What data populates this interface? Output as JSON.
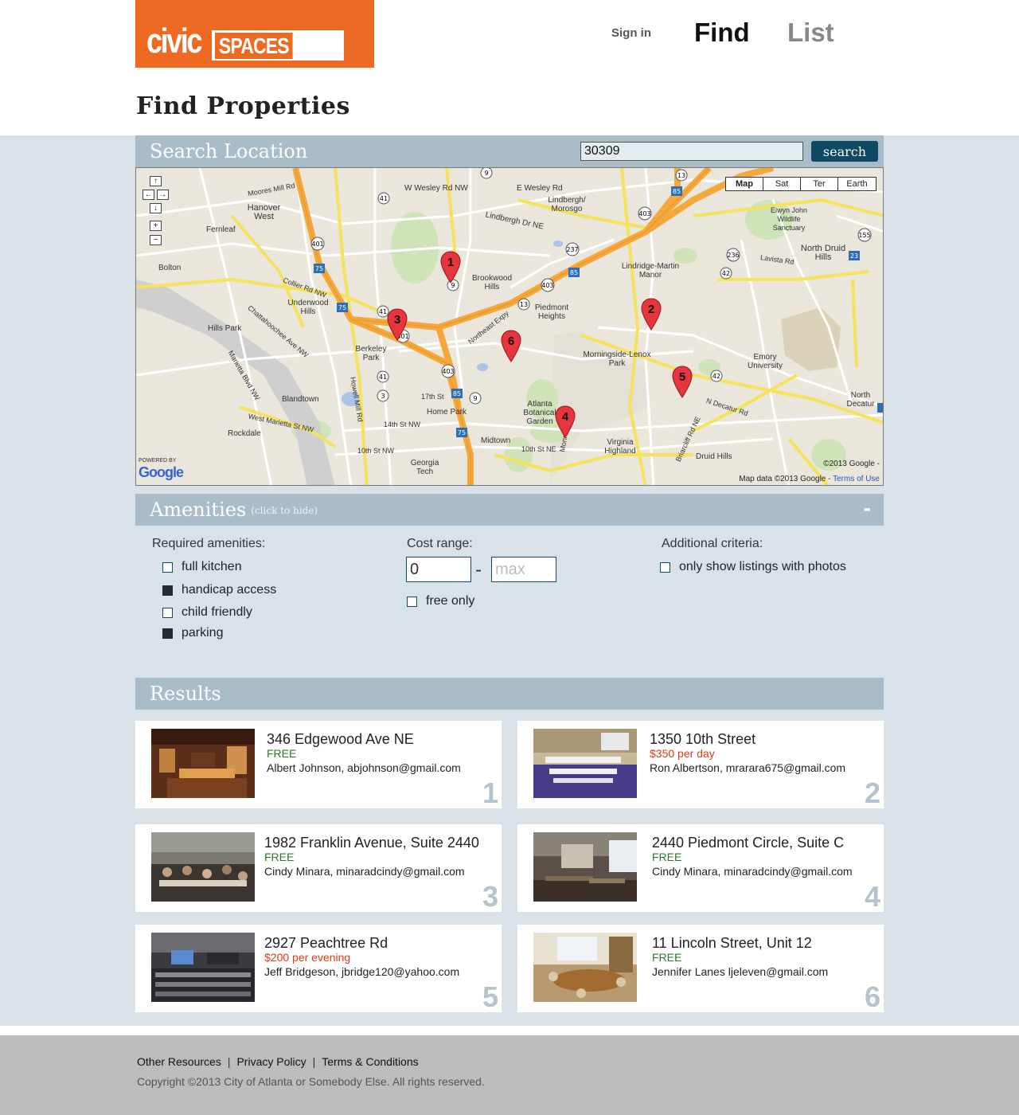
{
  "header": {
    "logo_civic": "civic",
    "logo_spaces": "SPACES",
    "sign_in": "Sign in",
    "nav_find": "Find",
    "nav_list": "List"
  },
  "page_title": "Find Properties",
  "search": {
    "title": "Search Location",
    "value": "30309",
    "button": "search"
  },
  "map": {
    "types": [
      "Map",
      "Sat",
      "Ter",
      "Earth"
    ],
    "active_type": "Map",
    "labels": [
      "W Wesley Rd NW",
      "E Wesley Rd",
      "Lindbergh/ Morosgo",
      "Lindbergh Dr NE",
      "Hanover West",
      "Fernleaf",
      "Bolton",
      "Brookwood Hills",
      "Piedmont Heights",
      "Lindridge-Martin Manor",
      "Elwyn John Wildlife Sanctuary",
      "North Druid Hills",
      "Underwood Hills",
      "Hills Park",
      "Berkeley Park",
      "Morningside-Lenox Park",
      "Emory University",
      "Blandtown",
      "Home Park",
      "Atlanta Botanical Garden",
      "Rockdale",
      "Midtown",
      "Virginia Highland",
      "Georgia Tech",
      "North Decatur",
      "Druid Hills",
      "17th St",
      "14th St NW",
      "10th St NW",
      "10th St NE",
      "Northeast Expy",
      "Collier Rd NW",
      "Lavista Rd",
      "N Decatur Rd",
      "Moores Mill Rd",
      "West Marietta St NW",
      "Marietta Blvd NW",
      "Chattahoochee Ave NW",
      "Howell Mill Rd",
      "Briarcliff Rd NE",
      "Monroe Dr"
    ],
    "copyright": "©2013 Google -",
    "data_text": "Map data ©2013 Google -",
    "terms": "Terms of Use",
    "powered_by": "POWERED BY",
    "google": "Google",
    "pan_up": "↑",
    "pan_left": "←",
    "pan_right": "→",
    "pan_down": "↓",
    "zoom_in": "+",
    "zoom_out": "−",
    "markers": [
      "1",
      "2",
      "3",
      "4",
      "5",
      "6"
    ]
  },
  "amenities": {
    "title": "Amenities",
    "hint": "(click to hide)",
    "toggle": "-",
    "required_label": "Required amenities:",
    "items": [
      {
        "label": "full kitchen",
        "checked": false
      },
      {
        "label": "handicap access",
        "checked": true
      },
      {
        "label": "child friendly",
        "checked": false
      },
      {
        "label": "parking",
        "checked": true
      }
    ],
    "cost_label": "Cost range:",
    "cost_min": "0",
    "cost_max_placeholder": "max",
    "cost_dash": "-",
    "free_only": "free only",
    "additional_label": "Additional criteria:",
    "photos_only": "only show listings with photos"
  },
  "results": {
    "title": "Results",
    "items": [
      {
        "address": "346 Edgewood Ave NE",
        "price": "FREE",
        "free": true,
        "contact": "Albert Johnson, abjohnson@gmail.com",
        "num": "1"
      },
      {
        "address": "1350 10th Street",
        "price": "$350 per day",
        "free": false,
        "contact": "Ron Albertson, mrarara675@gmail.com",
        "num": "2"
      },
      {
        "address": "1982 Franklin Avenue, Suite 2440",
        "price": "FREE",
        "free": true,
        "contact": "Cindy Minara, minaradcindy@gmail.com",
        "num": "3"
      },
      {
        "address": "2440 Piedmont Circle, Suite C",
        "price": "FREE",
        "free": true,
        "contact": "Cindy Minara, minaradcindy@gmail.com",
        "num": "4"
      },
      {
        "address": "2927 Peachtree Rd",
        "price": "$200 per evening",
        "free": false,
        "contact": "Jeff Bridgeson, jbridge120@yahoo.com",
        "num": "5"
      },
      {
        "address": "11 Lincoln Street, Unit 12",
        "price": "FREE",
        "free": true,
        "contact": "Jennifer Lanes ljeleven@gmail.com",
        "num": "6"
      }
    ]
  },
  "footer": {
    "other_resources": "Other Resources",
    "privacy": "Privacy Policy",
    "terms": "Terms & Conditions",
    "sep": "|",
    "copyright": "Copyright ©2013 City of Atlanta or Somebody Else. All rights reserved."
  },
  "colors": {
    "brand_orange": "#ee6a22",
    "section_bar": "#a9bcc8",
    "background": "#d8e2e8",
    "button": "#0e4a64",
    "free_green": "#2a7a2a",
    "paid_red": "#e03a10",
    "marker_red": "#e8343c"
  }
}
